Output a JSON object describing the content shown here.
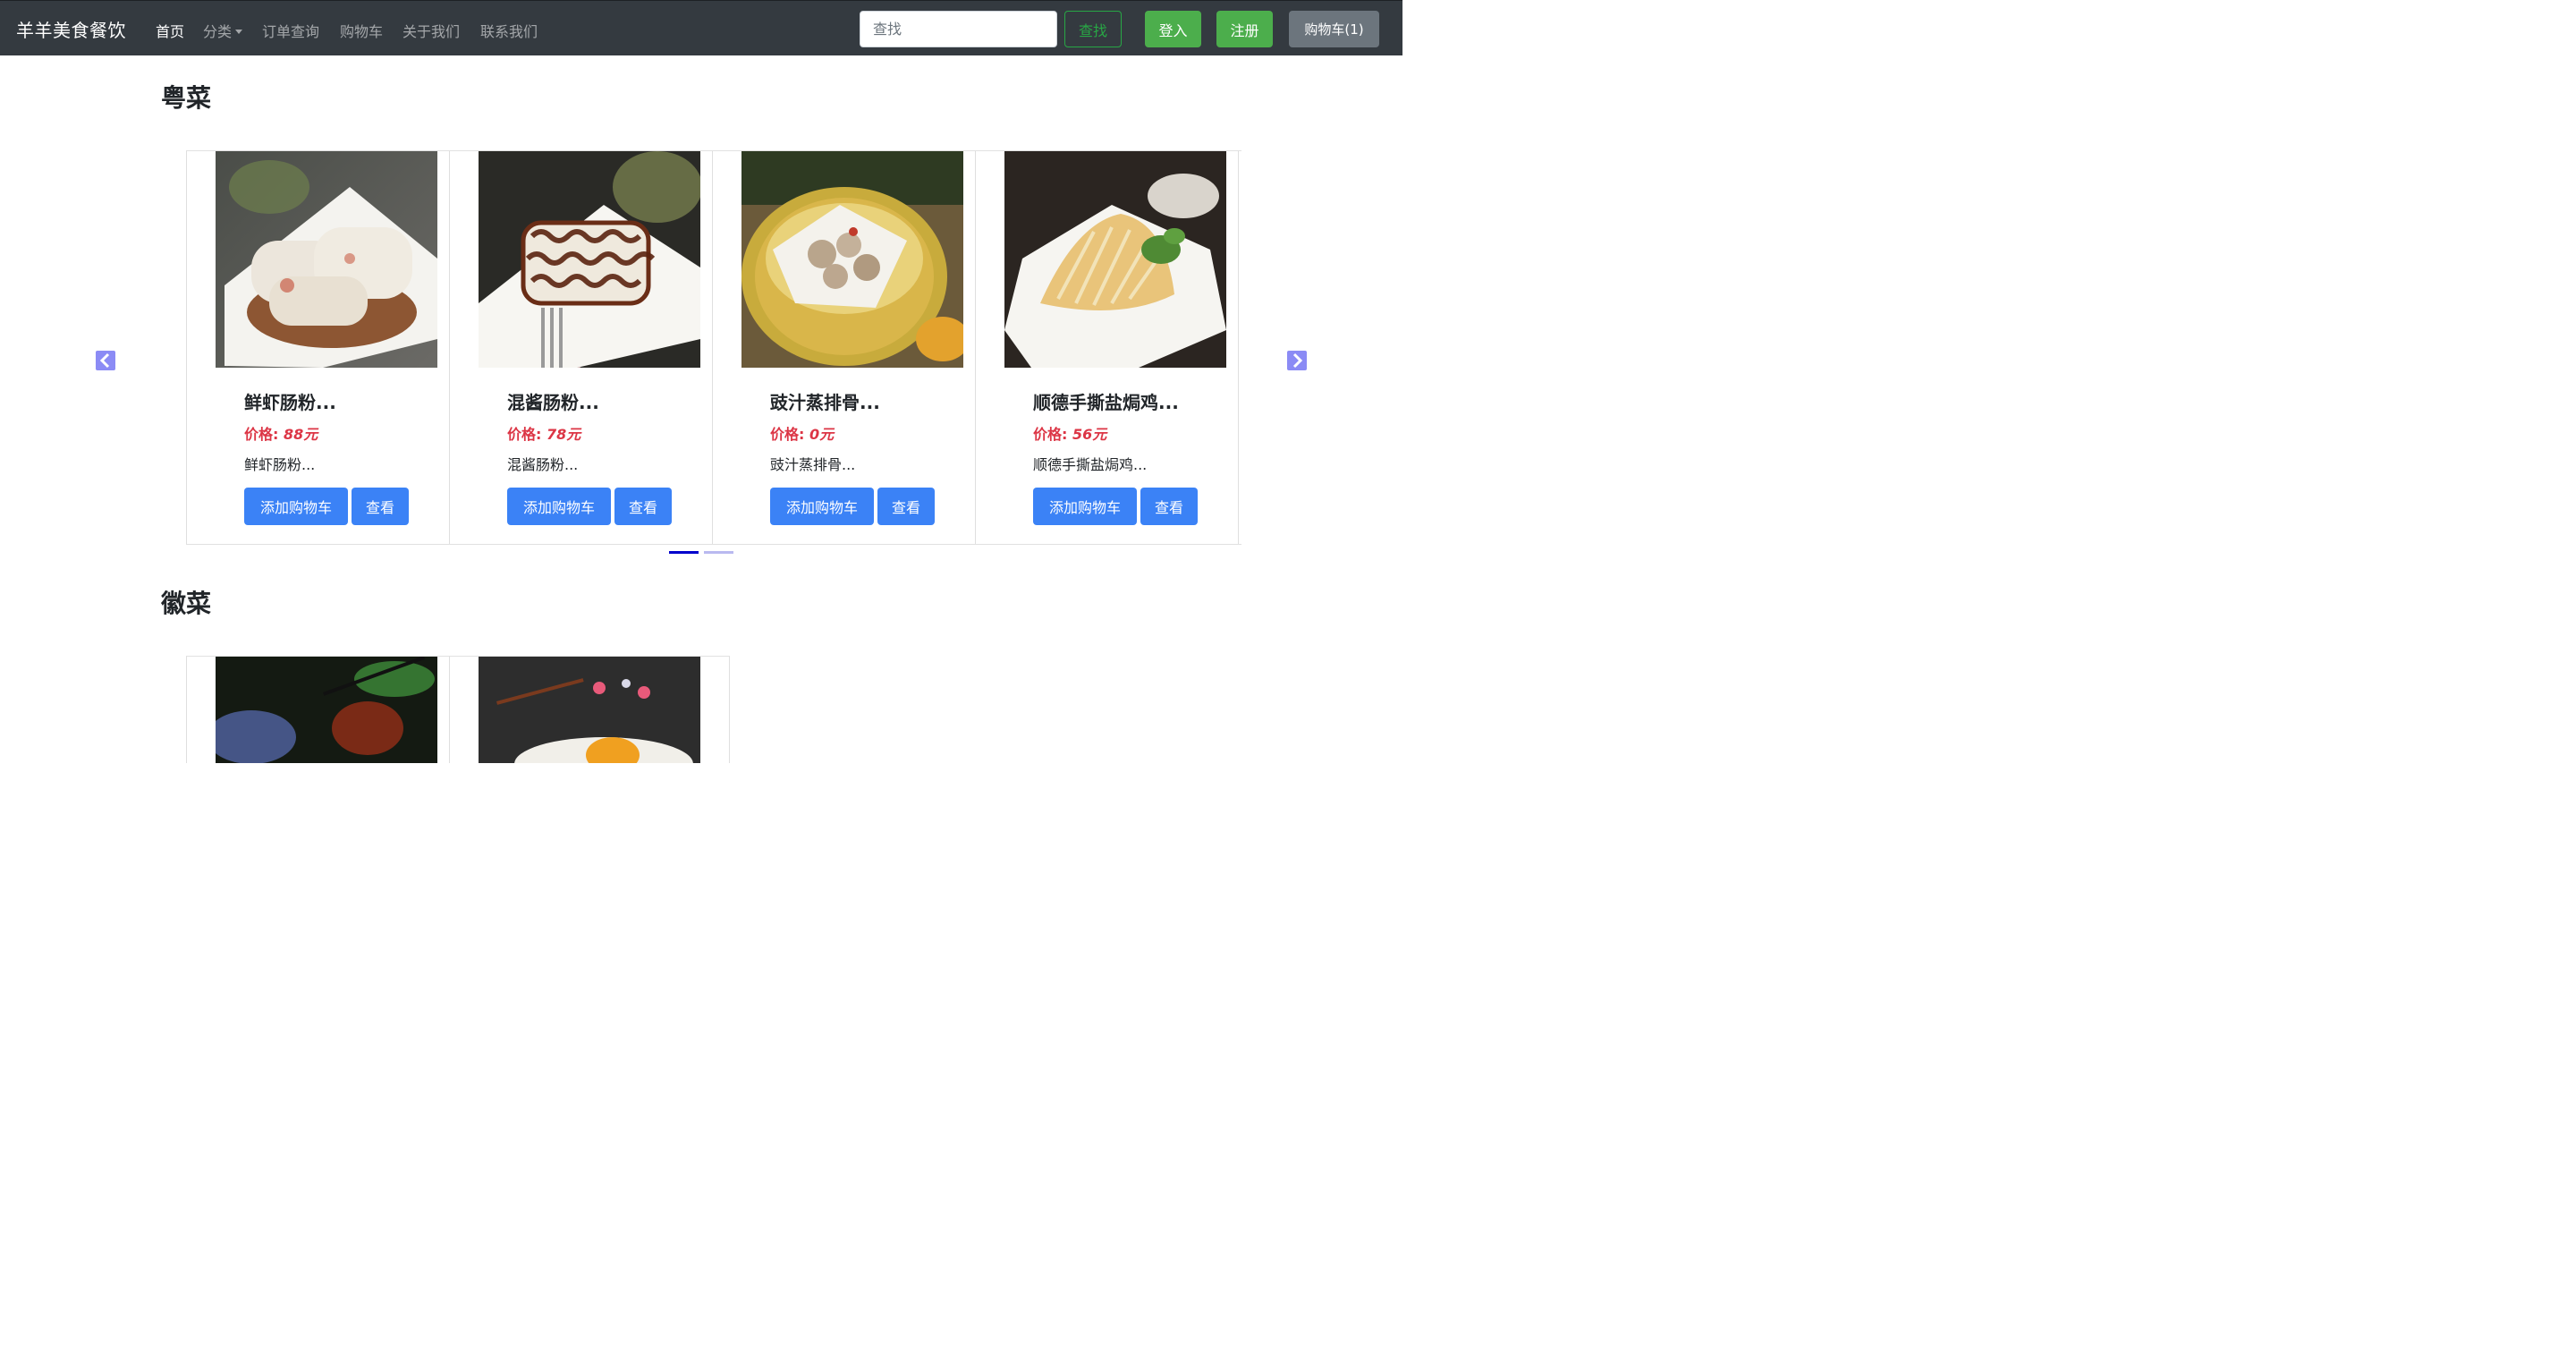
{
  "navbar": {
    "brand": "羊羊美食餐饮",
    "links": [
      {
        "label": "首页",
        "active": true
      },
      {
        "label": "分类",
        "dropdown": true
      },
      {
        "label": "订单查询"
      },
      {
        "label": "购物车"
      },
      {
        "label": "关于我们"
      },
      {
        "label": "联系我们"
      }
    ],
    "search_placeholder": "查找",
    "search_button": "查找",
    "login_button": "登入",
    "register_button": "注册",
    "cart_button": "购物车(1)"
  },
  "sections": [
    {
      "title": "粤菜",
      "carousel": {
        "prev_icon": "chevron-left-icon",
        "next_icon": "chevron-right-icon",
        "active_indicator": 0,
        "indicator_count": 2,
        "cards": [
          {
            "title": "鲜虾肠粉...",
            "price_label": "价格:",
            "price_value": "88元",
            "description": "鲜虾肠粉...",
            "add_button": "添加购物车",
            "view_button": "查看",
            "image": "rice-noodle-roll-photo"
          },
          {
            "title": "混酱肠粉...",
            "price_label": "价格:",
            "price_value": "78元",
            "description": "混酱肠粉...",
            "add_button": "添加购物车",
            "view_button": "查看",
            "image": "sauced-rice-roll-photo"
          },
          {
            "title": "豉汁蒸排骨...",
            "price_label": "价格:",
            "price_value": "0元",
            "description": "豉汁蒸排骨...",
            "add_button": "添加购物车",
            "view_button": "查看",
            "image": "steamed-ribs-photo"
          },
          {
            "title": "顺德手撕盐焗鸡...",
            "price_label": "价格:",
            "price_value": "56元",
            "description": "顺德手撕盐焗鸡...",
            "add_button": "添加购物车",
            "view_button": "查看",
            "image": "salt-baked-chicken-photo"
          }
        ]
      }
    },
    {
      "title": "徽菜",
      "carousel": {
        "cards": [
          {
            "image": "anhui-dish-photo-1"
          },
          {
            "image": "anhui-dish-photo-2"
          }
        ]
      }
    }
  ],
  "colors": {
    "navbar_bg": "#343a40",
    "success": "#4cae4c",
    "primary": "#3b82f6",
    "price": "#dc3545",
    "indicator_active": "#0000cc",
    "indicator_inactive": "#b9b9f0",
    "arrow": "#8b8bf5"
  }
}
